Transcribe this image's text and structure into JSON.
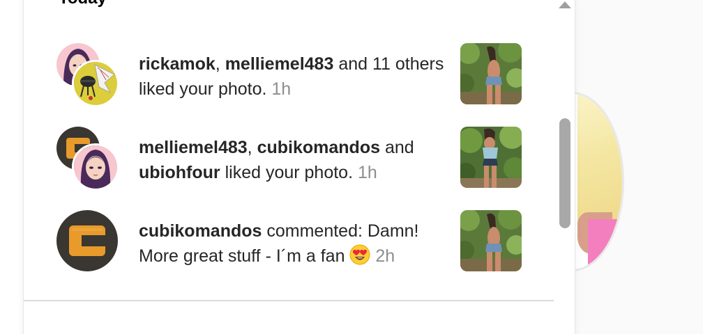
{
  "section": {
    "title": "Today"
  },
  "notifications": [
    {
      "users": [
        "rickamok",
        "melliemel483"
      ],
      "sep1": ", ",
      "mid": " and 11 others liked your photo. ",
      "time": "1h",
      "avatars": [
        "anime-girl-avatar",
        "bbq-grill-avatar"
      ],
      "thumb": "photo-thumbnail-woman-back"
    },
    {
      "users": [
        "melliemel483",
        "cubikomandos",
        "ubiohfour"
      ],
      "sep1": ", ",
      "and": " and ",
      "mid": " liked your photo. ",
      "time": "1h",
      "avatars": [
        "letter-c-avatar",
        "anime-girl-avatar"
      ],
      "thumb": "photo-thumbnail-woman-front"
    },
    {
      "user": "cubikomandos",
      "mid": " commented: Damn! More great stuff - I´m a fan ",
      "emoji": "heart-eyes-emoji",
      "time": "2h",
      "avatars": [
        "letter-c-avatar"
      ],
      "thumb": "photo-thumbnail-woman-back"
    }
  ],
  "colors": {
    "username": "#262626",
    "timestamp": "#8e8e8e",
    "scrollbar": "#a8a8a8",
    "c_logo": "#e89a2b"
  }
}
